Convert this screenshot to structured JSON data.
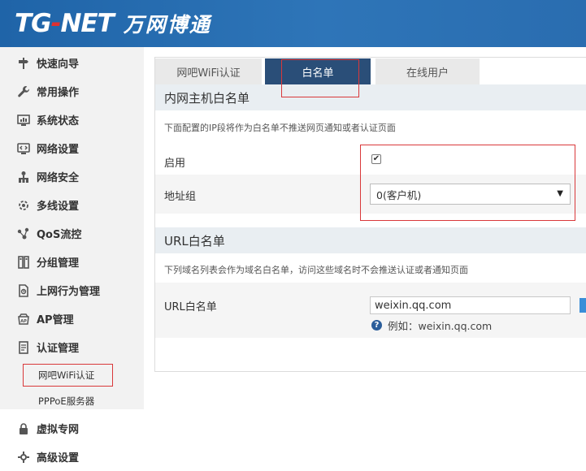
{
  "brand": {
    "logo_en_a": "TG",
    "logo_en_dash": "-",
    "logo_en_b": "NET",
    "logo_cn": "万网博通"
  },
  "sidebar": {
    "items": [
      {
        "label": "快速向导",
        "icon": "signpost-icon"
      },
      {
        "label": "常用操作",
        "icon": "wrench-icon"
      },
      {
        "label": "系统状态",
        "icon": "monitor-chart-icon"
      },
      {
        "label": "网络设置",
        "icon": "code-monitor-icon"
      },
      {
        "label": "网络安全",
        "icon": "network-security-icon"
      },
      {
        "label": "多线设置",
        "icon": "multiline-icon"
      },
      {
        "label": "QoS流控",
        "icon": "qos-icon"
      },
      {
        "label": "分组管理",
        "icon": "group-icon"
      },
      {
        "label": "上网行为管理",
        "icon": "behavior-icon"
      },
      {
        "label": "AP管理",
        "icon": "ap-icon"
      },
      {
        "label": "认证管理",
        "icon": "auth-icon"
      },
      {
        "label": "虚拟专网",
        "icon": "vpn-icon"
      },
      {
        "label": "高级设置",
        "icon": "advanced-icon"
      }
    ],
    "sub_items": [
      {
        "label": "网吧WiFi认证",
        "active": true
      },
      {
        "label": "PPPoE服务器",
        "active": false
      }
    ]
  },
  "tabs": [
    {
      "label": "网吧WiFi认证",
      "active": false
    },
    {
      "label": "白名单",
      "active": true
    },
    {
      "label": "在线用户",
      "active": false
    }
  ],
  "intranet_whitelist": {
    "title": "内网主机白名单",
    "desc": "下面配置的IP段将作为白名单不推送网页通知或者认证页面",
    "enable_label": "启用",
    "enable_checked": true,
    "address_group_label": "地址组",
    "address_group_value": "0(客户机)"
  },
  "url_whitelist": {
    "title": "URL白名单",
    "desc": "下列域名列表会作为域名白名单，访问这些域名时不会推送认证或者通知页面",
    "field_label": "URL白名单",
    "input_value": "weixin.qq.com",
    "hint": "例如：weixin.qq.com"
  },
  "colors": {
    "header": "#2a6db0",
    "active_tab": "#2a4e78",
    "highlight_box": "#d9383a",
    "sidebar_bg": "#f2f2f2"
  }
}
